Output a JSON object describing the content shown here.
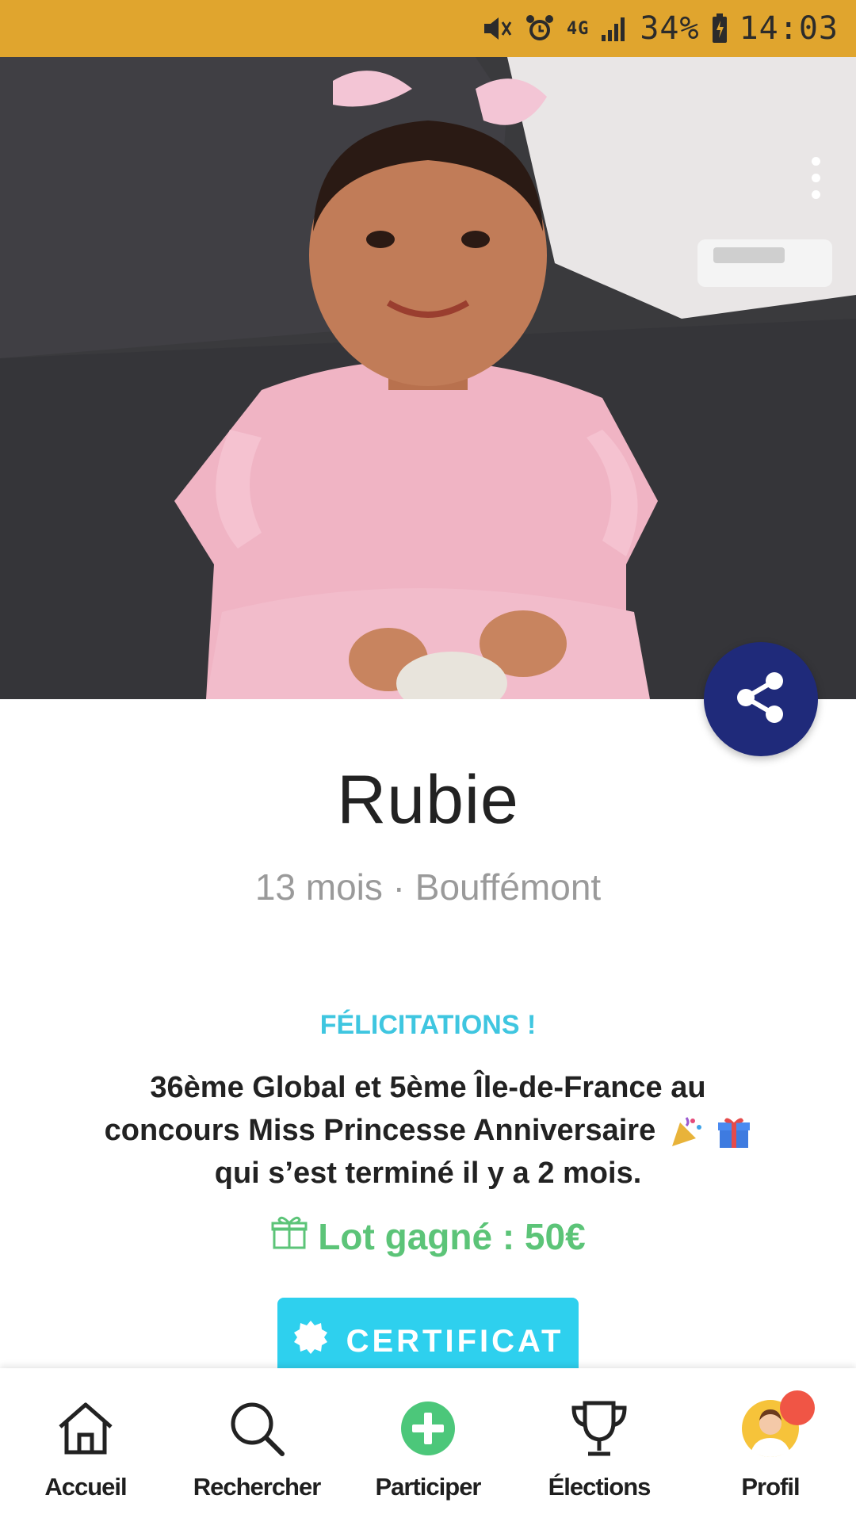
{
  "status_bar": {
    "network": "4G",
    "battery": "34%",
    "time": "14:03",
    "icons": [
      "mute-icon",
      "alarm-icon",
      "signal-icon",
      "battery-icon"
    ]
  },
  "profile": {
    "name": "Rubie",
    "meta": "13 mois · Bouffémont"
  },
  "result": {
    "congrats": "FÉLICITATIONS !",
    "line1": "36ème Global et 5ème Île-de-France au",
    "line2": "concours Miss Princesse Anniversaire",
    "line3": "qui s’est terminé il y a 2 mois.",
    "prize": "Lot gagné : 50€"
  },
  "certificate_button": {
    "label": "CERTIFICAT"
  },
  "bottom_nav": {
    "items": [
      {
        "label": "Accueil",
        "icon": "home-icon"
      },
      {
        "label": "Rechercher",
        "icon": "search-icon"
      },
      {
        "label": "Participer",
        "icon": "plus-circle-icon"
      },
      {
        "label": "Élections",
        "icon": "trophy-icon"
      },
      {
        "label": "Profil",
        "icon": "avatar-icon"
      }
    ]
  },
  "colors": {
    "status_bar": "#E0A52E",
    "accent_cyan": "#2ED0EE",
    "congrats_cyan": "#3FC6E0",
    "prize_green": "#5CC478",
    "fab_navy": "#1F2A7A",
    "notification_red": "#F05545"
  }
}
